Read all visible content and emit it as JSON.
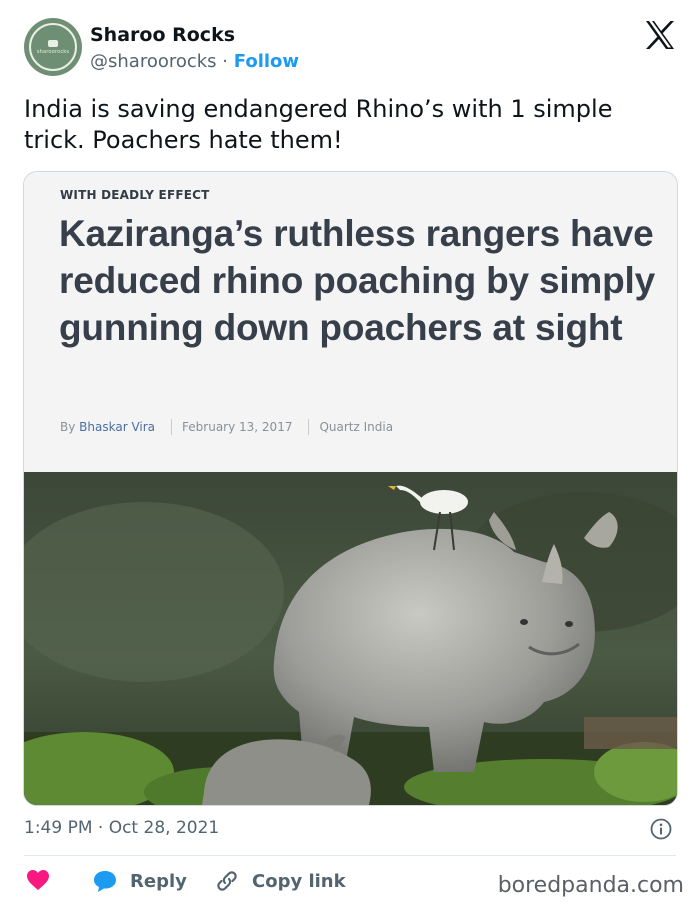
{
  "author": {
    "display_name": "Sharoo Rocks",
    "handle": "@sharoorocks",
    "separator": "·",
    "follow_label": "Follow",
    "avatar_text": "sharoorocks"
  },
  "tweet": {
    "text": "India is saving endangered Rhino’s with 1 simple trick. Poachers hate them!",
    "timestamp": "1:49 PM · Oct 28, 2021"
  },
  "article": {
    "kicker": "WITH DEADLY EFFECT",
    "headline": "Kaziranga’s ruthless rangers have reduced rhino poaching by simply gunning down poachers at sight",
    "byline_prefix": "By",
    "author": "Bhaskar Vira",
    "date": "February 13, 2017",
    "source": "Quartz India"
  },
  "actions": {
    "reply_label": "Reply",
    "copy_label": "Copy link"
  },
  "watermark": "boredpanda.com",
  "colors": {
    "follow": "#1d9bf0",
    "heart": "#f91880",
    "reply_bubble": "#1d9bf0",
    "text_secondary": "#536471"
  },
  "icons": [
    "x-logo-icon",
    "info-icon",
    "heart-icon",
    "reply-icon",
    "link-icon"
  ]
}
